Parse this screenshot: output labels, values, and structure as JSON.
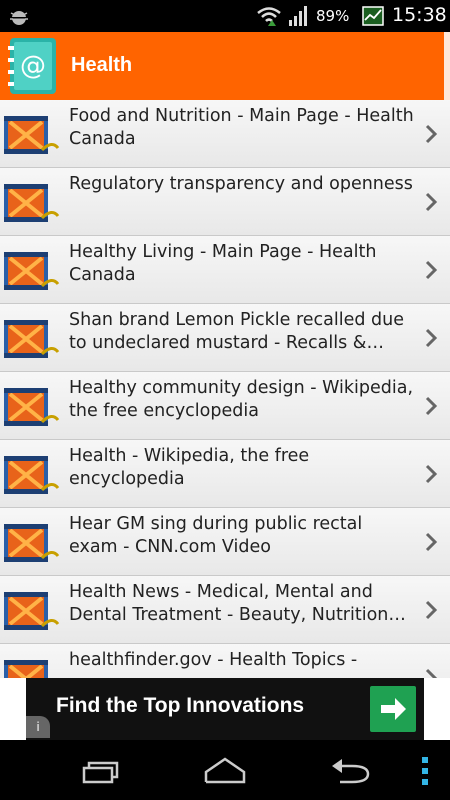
{
  "status_bar": {
    "battery_percent": "89%",
    "time": "15:38"
  },
  "action_bar": {
    "title": "Health"
  },
  "list": {
    "items": [
      {
        "title": "Food and Nutrition - Main Page - Health Canada"
      },
      {
        "title": "Regulatory transparency and openness"
      },
      {
        "title": "Healthy Living - Main Page - Health Canada"
      },
      {
        "title": "Shan brand Lemon Pickle recalled due to undeclared mustard - Recalls & Safety Alerts"
      },
      {
        "title": "Healthy community design - Wikipedia, the free encyclopedia"
      },
      {
        "title": "Health - Wikipedia, the free encyclopedia"
      },
      {
        "title": "Hear GM sing during public rectal exam - CNN.com Video"
      },
      {
        "title": "Health News - Medical, Mental and Dental Treatment - Beauty, Nutrition and Fitness"
      },
      {
        "title": "healthfinder.gov - Health Topics -"
      }
    ]
  },
  "ad": {
    "text": "Find the Top Innovations",
    "info_label": "i"
  }
}
